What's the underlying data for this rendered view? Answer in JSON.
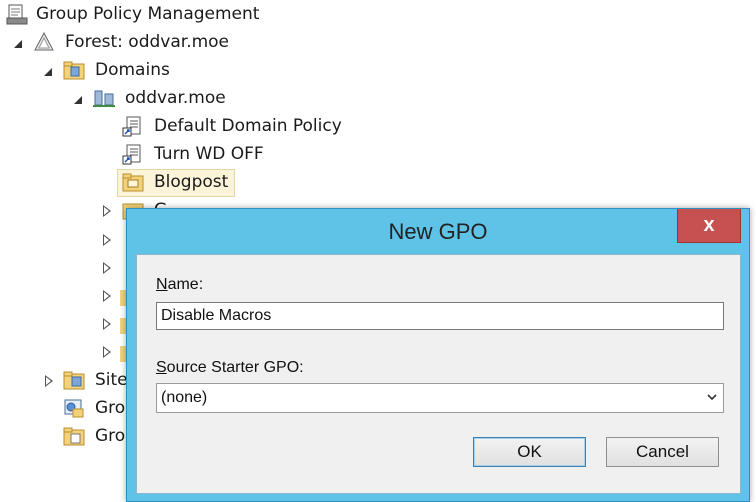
{
  "tree": {
    "root": "Group Policy Management",
    "forest": "Forest: oddvar.moe",
    "domains": "Domains",
    "domain": "oddvar.moe",
    "gpo_links": [
      "Default Domain Policy",
      "Turn WD OFF",
      "Blogpost"
    ],
    "partial_hidden_label": "G",
    "sites_partial": "Site",
    "group_policy_partial_1": "Gro",
    "group_policy_partial_2": "Gro"
  },
  "dialog": {
    "title": "New GPO",
    "close_glyph": "x",
    "name_label_accel": "N",
    "name_label_rest": "ame:",
    "name_value": "Disable Macros",
    "source_label_accel": "S",
    "source_label_rest": "ource Starter GPO:",
    "source_value": "(none)",
    "ok_label": "OK",
    "cancel_label": "Cancel"
  },
  "colors": {
    "dialog_frame": "#5fc3e8",
    "close_button": "#c75050",
    "selection_bg": "#fcf4d9"
  }
}
